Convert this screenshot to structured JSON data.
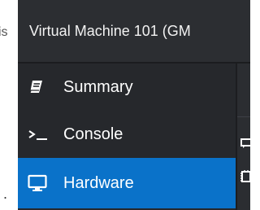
{
  "outside": {
    "clipped_text": "is"
  },
  "window": {
    "title": "Virtual Machine 101 (GM"
  },
  "nav": {
    "items": [
      {
        "label": "Summary",
        "icon": "book-icon",
        "active": false
      },
      {
        "label": "Console",
        "icon": "terminal-icon",
        "active": false
      },
      {
        "label": "Hardware",
        "icon": "monitor-icon",
        "active": true
      }
    ]
  },
  "colors": {
    "panel_bg": "#2f3136",
    "nav_bg": "#26282c",
    "active_bg": "#0a72c9",
    "text": "#ffffff"
  }
}
